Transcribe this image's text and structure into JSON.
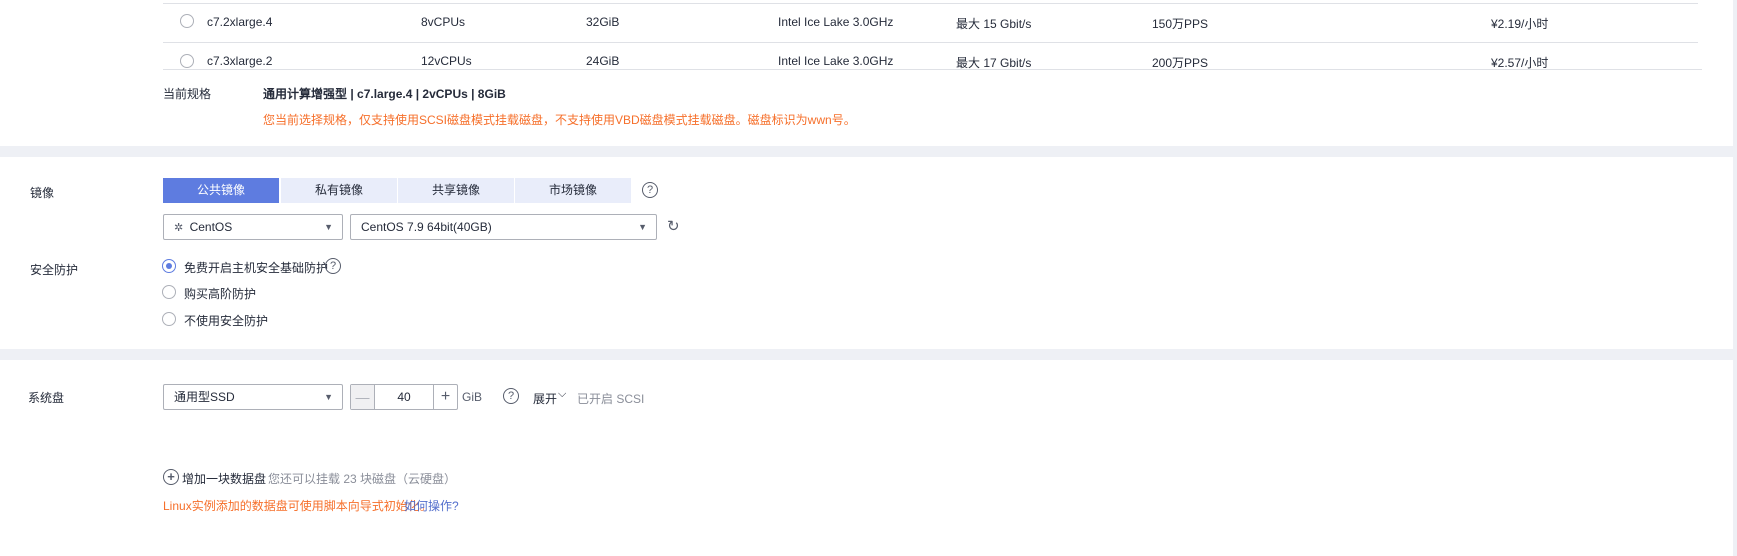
{
  "flavor_table": {
    "rows": [
      {
        "name": "c7.2xlarge.4",
        "vcpus": "8vCPUs",
        "memory": "32GiB",
        "cpu": "Intel Ice Lake 3.0GHz",
        "bandwidth": "最大 15 Gbit/s",
        "pps": "150万PPS",
        "price": "¥2.19/小时",
        "selected": false
      },
      {
        "name": "c7.3xlarge.2",
        "vcpus": "12vCPUs",
        "memory": "24GiB",
        "cpu": "Intel Ice Lake 3.0GHz",
        "bandwidth": "最大 17 Gbit/s",
        "pps": "200万PPS",
        "price": "¥2.57/小时",
        "selected": false
      }
    ]
  },
  "current_spec": {
    "label": "当前规格",
    "value": "通用计算增强型 | c7.large.4 | 2vCPUs | 8GiB",
    "warning": "您当前选择规格，仅支持使用SCSI磁盘模式挂载磁盘，不支持使用VBD磁盘模式挂载磁盘。磁盘标识为wwn号。"
  },
  "image": {
    "label": "镜像",
    "tabs": [
      "公共镜像",
      "私有镜像",
      "共享镜像",
      "市场镜像"
    ],
    "active_tab": 0,
    "os": "CentOS",
    "version": "CentOS 7.9 64bit(40GB)"
  },
  "security": {
    "label": "安全防护",
    "options": [
      "免费开启主机安全基础防护",
      "购买高阶防护",
      "不使用安全防护"
    ],
    "selected": 0
  },
  "system_disk": {
    "label": "系统盘",
    "type": "通用型SSD",
    "size": "40",
    "unit": "GiB",
    "expand": "展开",
    "scsi": "已开启 SCSI",
    "add_disk": "增加一块数据盘",
    "add_hint": "您还可以挂载 23 块磁盘（云硬盘）",
    "linux_note": "Linux实例添加的数据盘可使用脚本向导式初始化。",
    "how_link": "如何操作?"
  },
  "colors": {
    "accent": "#5e7ce0",
    "warning": "#f66f2a"
  }
}
